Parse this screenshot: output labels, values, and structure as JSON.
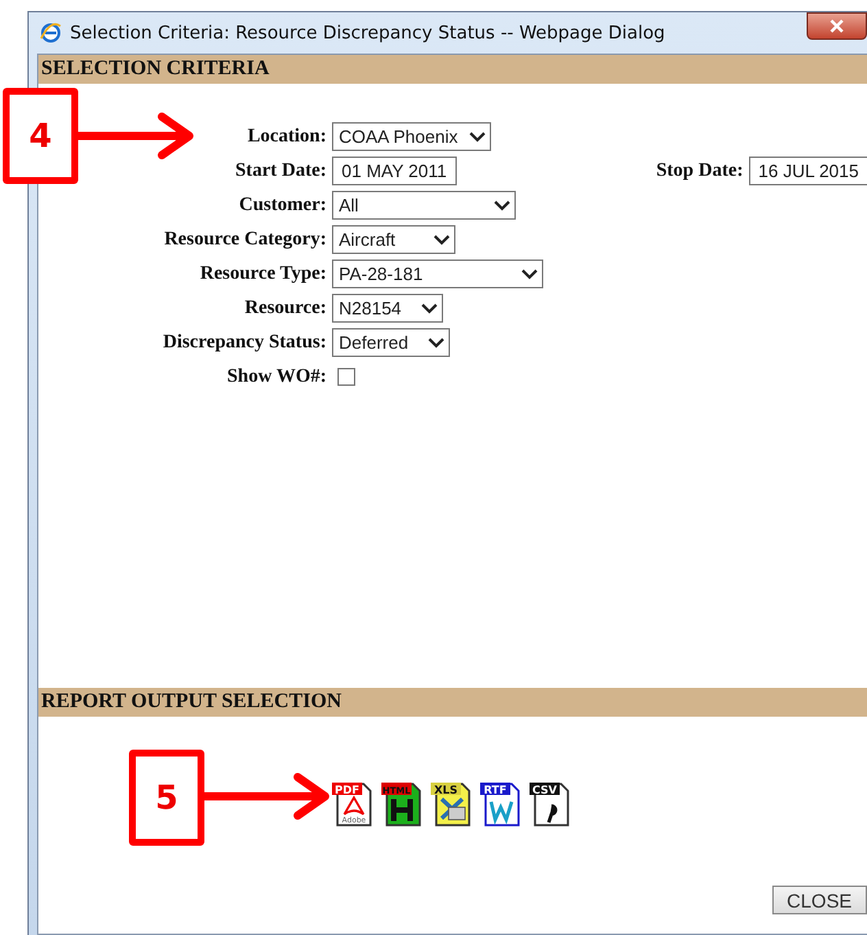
{
  "window": {
    "title": "Selection Criteria: Resource Discrepancy Status -- Webpage Dialog"
  },
  "selection_criteria": {
    "heading": "SELECTION CRITERIA",
    "callout": "4",
    "fields": [
      {
        "kind": "select",
        "label": "Location:",
        "value": "COAA Phoenix"
      },
      {
        "kind": "date_range",
        "label": "Start Date:",
        "value": "01 MAY 2011",
        "end_label": "Stop Date:",
        "end_value": "16 JUL 2015"
      },
      {
        "kind": "select",
        "label": "Customer:",
        "value": "All"
      },
      {
        "kind": "select",
        "label": "Resource Category:",
        "value": "Aircraft"
      },
      {
        "kind": "select",
        "label": "Resource Type:",
        "value": "PA-28-181"
      },
      {
        "kind": "select",
        "label": "Resource:",
        "value": "N28154"
      },
      {
        "kind": "select",
        "label": "Discrepancy Status:",
        "value": "Deferred"
      },
      {
        "kind": "checkbox",
        "label": "Show WO#:",
        "checked": false
      }
    ]
  },
  "report_output": {
    "heading": "REPORT OUTPUT SELECTION",
    "callout": "5",
    "formats": [
      {
        "kind": "pdf",
        "label": "PDF",
        "sublabel": "Adobe"
      },
      {
        "kind": "html",
        "label": "HTML"
      },
      {
        "kind": "xls",
        "label": "XLS"
      },
      {
        "kind": "rtf",
        "label": "RTF"
      },
      {
        "kind": "csv",
        "label": "CSV"
      }
    ]
  },
  "close_button": "CLOSE"
}
